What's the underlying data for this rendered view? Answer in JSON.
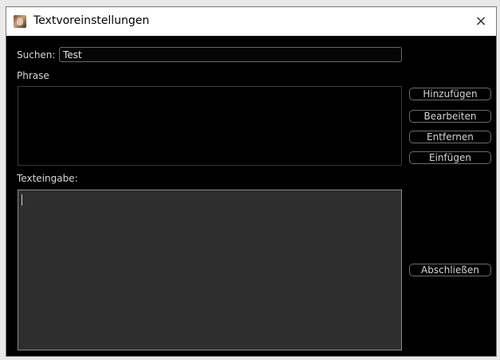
{
  "window": {
    "title": "Textvoreinstellungen",
    "close_glyph": "×"
  },
  "search": {
    "label": "Suchen:",
    "value": "Test"
  },
  "phrase": {
    "label": "Phrase",
    "items": []
  },
  "buttons": {
    "add": "Hinzufügen",
    "edit": "Bearbeiten",
    "remove": "Entfernen",
    "insert": "Einfügen",
    "finish": "Abschließen"
  },
  "text_input": {
    "label": "Texteingabe:",
    "value": ""
  },
  "icons": {
    "app": "app-icon",
    "close": "close-icon"
  },
  "colors": {
    "background": "#000000",
    "titlebar": "#ffffff",
    "text": "#d8d8d8",
    "textarea_bg": "#2e2e2e"
  }
}
